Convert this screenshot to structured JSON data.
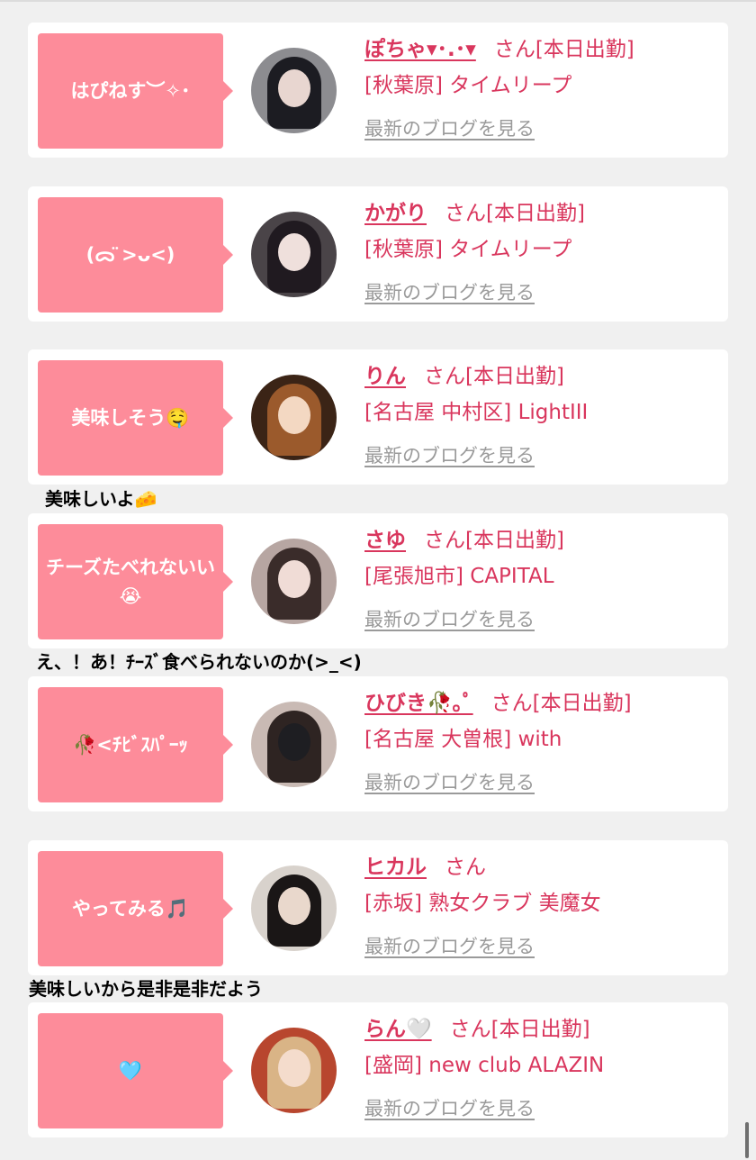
{
  "cards": [
    {
      "bubble": "はぴねす︶✧･",
      "name": "ぽちゃ▾･.･▾",
      "suffix": "さん[本日出勤]",
      "shop": "[秋葉原] タイムリープ",
      "blog": "最新のブログを見る",
      "avatar_colors": {
        "bg": "#8c8c90",
        "hair": "#1c1c22",
        "face": "#e8d6d0"
      }
    },
    {
      "bubble": "(ᯅ̈ >ᴗ<)",
      "name": "かがり",
      "suffix": "さん[本日出勤]",
      "shop": "[秋葉原] タイムリープ",
      "blog": "最新のブログを見る",
      "avatar_colors": {
        "bg": "#4a4448",
        "hair": "#201a20",
        "face": "#efe0dc"
      }
    },
    {
      "bubble": "美味しそう🤤",
      "name": "りん",
      "suffix": "さん[本日出勤]",
      "shop": "[名古屋 中村区] LightIII",
      "blog": "最新のブログを見る",
      "avatar_colors": {
        "bg": "#3b2416",
        "hair": "#9b5a2c",
        "face": "#f3d8c2"
      }
    },
    {
      "bubble": "チーズたべれないい😭",
      "name": "さゆ",
      "suffix": "さん[本日出勤]",
      "shop": "[尾張旭市] CAPITAL",
      "blog": "最新のブログを見る",
      "avatar_colors": {
        "bg": "#b7a6a2",
        "hair": "#3a2c2a",
        "face": "#f0dcd6"
      }
    },
    {
      "bubble": "🥀<ﾁﾋﾞｽﾊﾟｰｯ",
      "name": "ひびき🥀｡ﾟ",
      "suffix": "さん[本日出勤]",
      "shop": "[名古屋 大曽根] with",
      "blog": "最新のブログを見る",
      "avatar_colors": {
        "bg": "#c9bab4",
        "hair": "#2e2422",
        "face": "#1e1e22"
      }
    },
    {
      "bubble": "やってみる🎵",
      "name": "ヒカル",
      "suffix": "さん",
      "shop": "[赤坂] 熟女クラブ 美魔女",
      "blog": "最新のブログを見る",
      "avatar_colors": {
        "bg": "#d8d2cc",
        "hair": "#1a1616",
        "face": "#e9d8cc"
      }
    },
    {
      "bubble": "🩵",
      "name": "らん🤍",
      "suffix": "さん[本日出勤]",
      "shop": "[盛岡] new club ALAZIN",
      "blog": "最新のブログを見る",
      "avatar_colors": {
        "bg": "#b8462e",
        "hair": "#d9b486",
        "face": "#f4dccc"
      }
    }
  ],
  "overlays": [
    {
      "text": "美味しいよ🧀"
    },
    {
      "text": "え、！あ！ﾁｰｽﾞ食べられないのか(>_<)"
    },
    {
      "text": "美味しいから是非是非だよう"
    }
  ],
  "colors": {
    "accent": "#d9365d",
    "bubble": "#fd8c9a",
    "link_gray": "#9a9a9a",
    "background": "#f0f0f0"
  }
}
